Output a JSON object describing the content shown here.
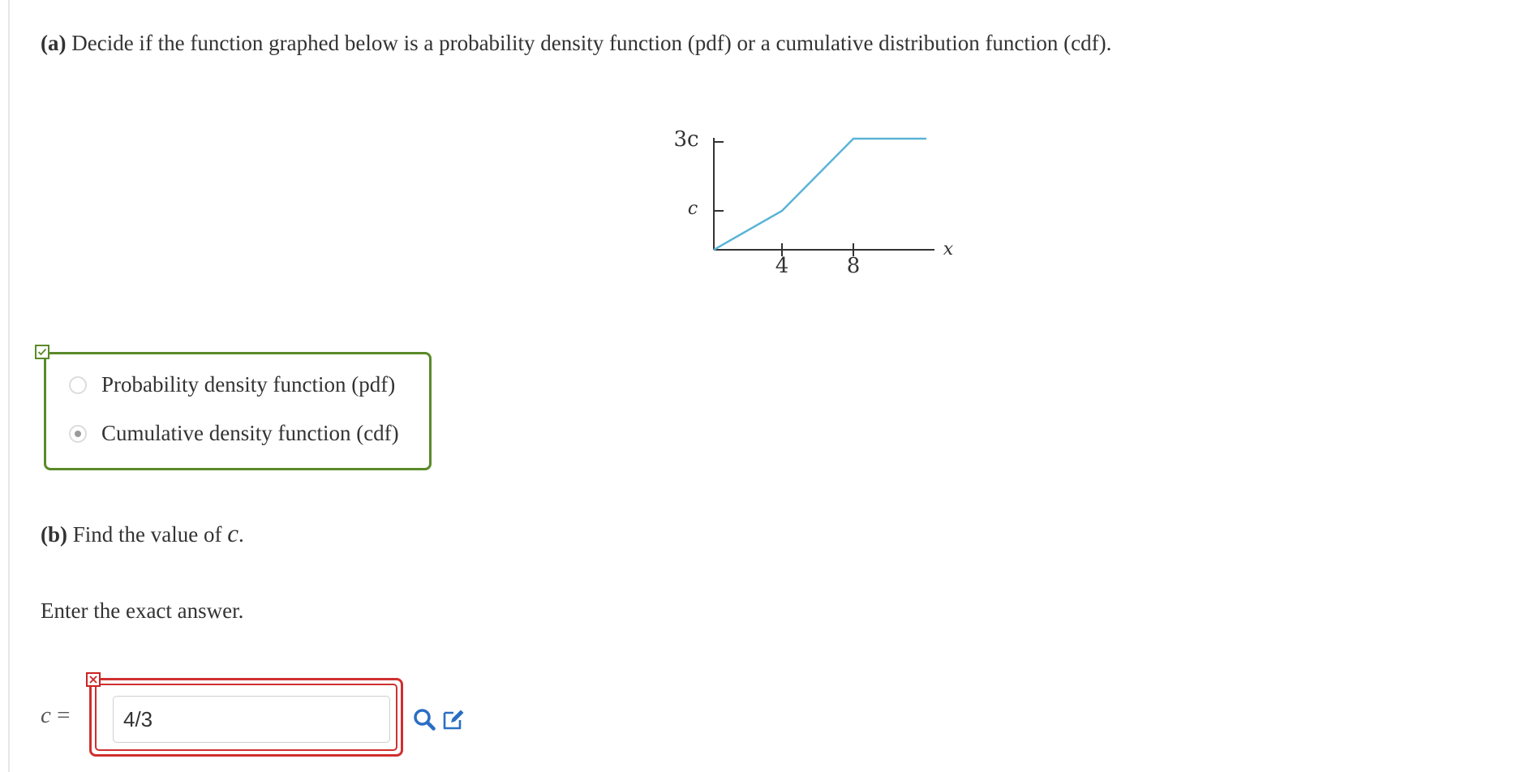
{
  "part_a": {
    "label": "(a)",
    "text": "Decide if the function graphed below is a probability density function (pdf) or a cumulative distribution function (cdf)."
  },
  "graph": {
    "y_tick_labels": [
      "3c",
      "c"
    ],
    "x_tick_labels": [
      "4",
      "8"
    ],
    "x_axis_label": "x",
    "line_color": "#5ab4d6"
  },
  "choices": {
    "status": "correct",
    "options": [
      {
        "label": "Probability density function (pdf)",
        "selected": false
      },
      {
        "label": "Cumulative density function (cdf)",
        "selected": true
      }
    ]
  },
  "part_b": {
    "label": "(b)",
    "text_before": "Find the value of",
    "variable": "c",
    "text_after": "."
  },
  "instruction": "Enter the exact answer.",
  "answer": {
    "variable": "c",
    "equals": "=",
    "value": "4/3",
    "status": "incorrect"
  },
  "tools": {
    "search_icon_color": "#2a6ec4",
    "edit_icon_color": "#2a6ec4"
  }
}
